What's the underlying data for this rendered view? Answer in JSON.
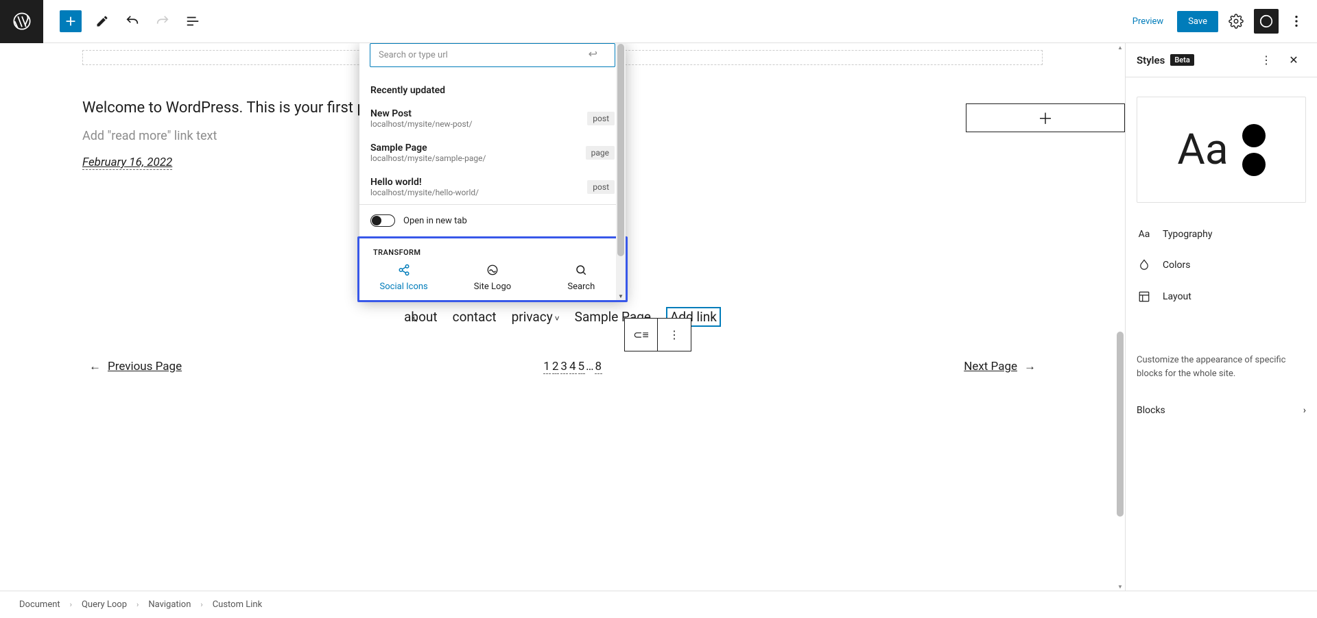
{
  "topbar": {
    "preview": "Preview",
    "save": "Save"
  },
  "canvas": {
    "post_text": "Welcome to WordPress. This is your first post. Edi",
    "readmore": "Add \"read more\" link text",
    "date": "February 16, 2022",
    "nav": {
      "about": "about",
      "contact": "contact",
      "privacy": "privacy",
      "sample": "Sample Page",
      "add_link": "Add link"
    },
    "pagination": {
      "prev": "Previous Page",
      "next": "Next Page",
      "nums": "1 2 3 4 5…8"
    }
  },
  "popover": {
    "search_placeholder": "Search or type url",
    "recent_header": "Recently updated",
    "items": [
      {
        "title": "New Post",
        "url": "localhost/mysite/new-post/",
        "type": "post"
      },
      {
        "title": "Sample Page",
        "url": "localhost/mysite/sample-page/",
        "type": "page"
      },
      {
        "title": "Hello world!",
        "url": "localhost/mysite/hello-world/",
        "type": "post"
      }
    ],
    "open_new_tab": "Open in new tab",
    "transform_header": "TRANSFORM",
    "transforms": {
      "social": "Social Icons",
      "sitelogo": "Site Logo",
      "search": "Search"
    }
  },
  "sidebar": {
    "title": "Styles",
    "beta": "Beta",
    "typography": "Typography",
    "colors": "Colors",
    "layout": "Layout",
    "desc": "Customize the appearance of specific blocks for the whole site.",
    "blocks": "Blocks"
  },
  "breadcrumb": {
    "a": "Document",
    "b": "Query Loop",
    "c": "Navigation",
    "d": "Custom Link"
  }
}
